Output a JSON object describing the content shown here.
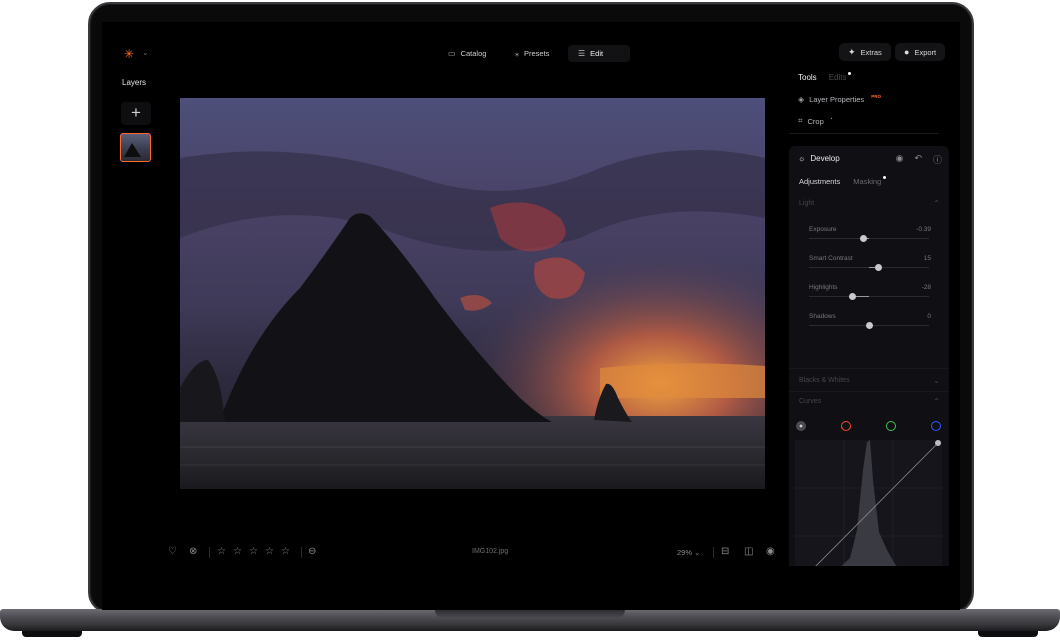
{
  "topbar": {
    "logo_icon": "luminar-star-icon",
    "tabs": [
      {
        "label": "Catalog",
        "icon": "folder-icon"
      },
      {
        "label": "Presets",
        "icon": "sparkle-wand-icon"
      },
      {
        "label": "Edit",
        "icon": "sliders-icon"
      }
    ],
    "extras_label": "Extras",
    "export_label": "Export"
  },
  "layers": {
    "title": "Layers",
    "add_symbol": "+"
  },
  "photo": {
    "filename": "IMG102.jpg"
  },
  "bottombar": {
    "zoom": "29%",
    "rating_stars": 0,
    "rating_max": 5
  },
  "right_panel": {
    "tabs": {
      "tools": "Tools",
      "edits": "Edits"
    },
    "layer_properties": "Layer Properties",
    "crop": "Crop",
    "pro_badge": "PRO",
    "develop": {
      "title": "Develop",
      "subtabs": {
        "adjustments": "Adjustments",
        "masking": "Masking"
      },
      "light_section": "Light",
      "sliders": [
        {
          "label": "Exposure",
          "value": "-0.39",
          "num": -0.39,
          "min": -4,
          "max": 4
        },
        {
          "label": "Smart Contrast",
          "value": "15",
          "num": 15,
          "min": -100,
          "max": 100
        },
        {
          "label": "Highlights",
          "value": "-28",
          "num": -28,
          "min": -100,
          "max": 100
        },
        {
          "label": "Shadows",
          "value": "0",
          "num": 0,
          "min": -100,
          "max": 100
        }
      ],
      "blacks_whites_section": "Blacks & Whites",
      "curves_section": "Curves",
      "curve_channels": [
        {
          "name": "rgb",
          "color": "#d0d0d4"
        },
        {
          "name": "red",
          "color": "#ff4a2a"
        },
        {
          "name": "green",
          "color": "#3cc24a"
        },
        {
          "name": "blue",
          "color": "#2a5bff"
        }
      ]
    }
  },
  "colors": {
    "accent": "#ff6a2a"
  }
}
